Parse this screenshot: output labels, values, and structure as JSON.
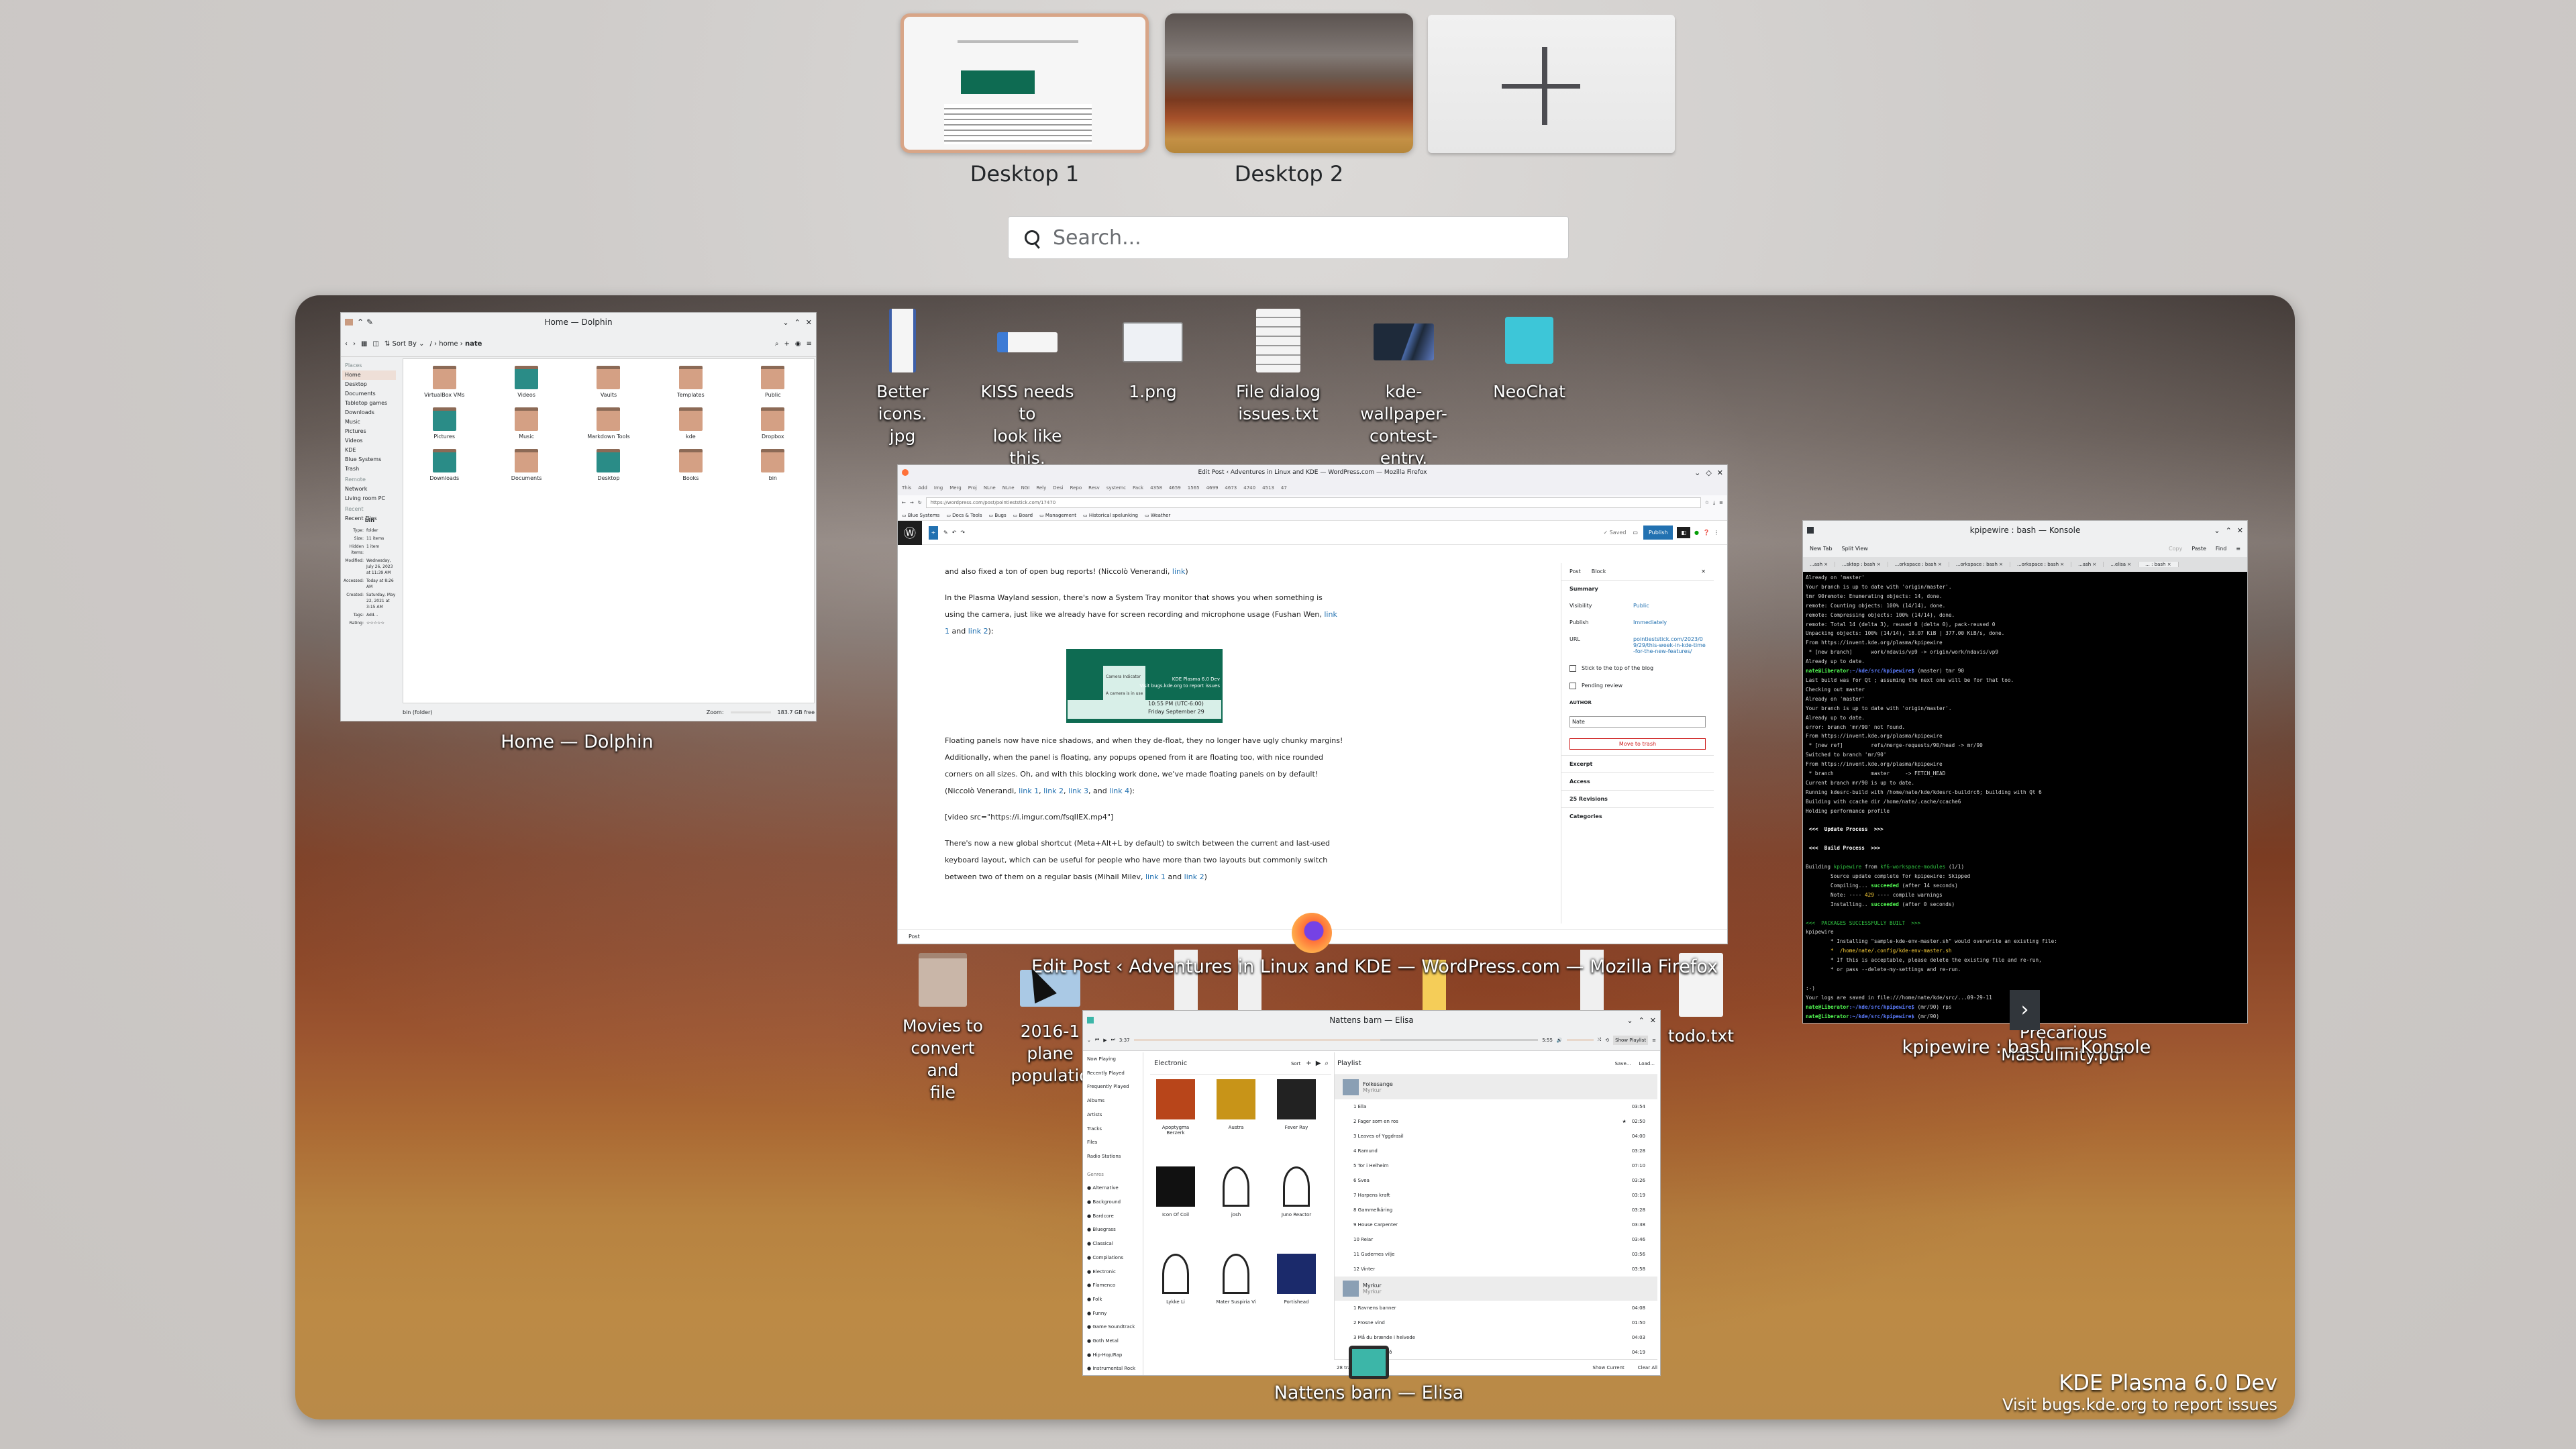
{
  "desktop_bar": {
    "desktops": [
      {
        "label": "Desktop 1",
        "active": true
      },
      {
        "label": "Desktop 2",
        "active": false
      }
    ],
    "add_desktop_icon": "plus-icon"
  },
  "search": {
    "placeholder": "Search...",
    "icon": "search-icon"
  },
  "desktop_icons": [
    {
      "label": "Better icons.\njpg",
      "icon": "image-file-icon"
    },
    {
      "label": "KISS needs to\nlook like this.\njpg",
      "icon": "image-file-icon"
    },
    {
      "label": "1.png",
      "icon": "image-file-icon"
    },
    {
      "label": "File dialog\nissues.txt",
      "icon": "text-file-icon"
    },
    {
      "label": "kde-wallpaper-\ncontest-entry.\npng",
      "icon": "image-file-icon"
    },
    {
      "label": "NeoChat",
      "icon": "neochat-icon"
    },
    {
      "label": "Movies to\nconvert and\nfile",
      "icon": "folder-icon"
    },
    {
      "label": "2016-1\nplane\npopulatio",
      "icon": "image-file-icon"
    },
    {
      "label": "todo.txt",
      "icon": "text-file-icon"
    },
    {
      "label": "Precarious\nMasculinity.pdf",
      "icon": "pdf-file-icon"
    }
  ],
  "windows": {
    "dolphin": {
      "title": "Home — Dolphin",
      "caption": "Home — Dolphin",
      "toolbar": {
        "sort_label": "Sort By",
        "breadcrumb": [
          "/",
          "home",
          "nate"
        ]
      },
      "places_header": "Places",
      "places": [
        "Home",
        "Desktop",
        "Documents",
        "Tabletop games",
        "Downloads",
        "Music",
        "Pictures",
        "Videos",
        "KDE",
        "Blue Systems",
        "Trash"
      ],
      "remote_header": "Remote",
      "remote": [
        "Network",
        "Living room PC"
      ],
      "recent_header": "Recent",
      "recent": [
        "Recent Files"
      ],
      "files": [
        "VirtualBox VMs",
        "Videos",
        "Vaults",
        "Templates",
        "Public",
        "Pictures",
        "Music",
        "Markdown Tools",
        "kde",
        "Dropbox",
        "Downloads",
        "Documents",
        "Desktop",
        "Books",
        "bin"
      ],
      "info_panel": {
        "name": "bin",
        "rows": [
          {
            "k": "Type:",
            "v": "folder"
          },
          {
            "k": "Size:",
            "v": "11 items"
          },
          {
            "k": "Hidden items:",
            "v": "1 item"
          },
          {
            "k": "Modified:",
            "v": "Wednesday, July 26, 2023 at 11:39 AM"
          },
          {
            "k": "Accessed:",
            "v": "Today at 8:26 AM"
          },
          {
            "k": "Created:",
            "v": "Saturday, May 22, 2021 at 3:15 AM"
          },
          {
            "k": "Tags:",
            "v": "Add..."
          },
          {
            "k": "Rating:",
            "v": "☆☆☆☆☆"
          }
        ]
      },
      "status": "bin (folder)",
      "zoom_label": "Zoom:",
      "free_space": "183.7 GB free"
    },
    "firefox": {
      "title": "Edit Post ‹ Adventures in Linux and KDE — WordPress.com — Mozilla Firefox",
      "caption": "Edit Post ‹ Adventures in Linux and KDE — WordPress.com — Mozilla Firefox",
      "tabs": [
        "This",
        "Add",
        "Img",
        "Merg",
        "Proj",
        "NLne",
        "NLne",
        "NGI",
        "Rely",
        "Desi",
        "Repo",
        "Resv",
        "systemc",
        "Pack",
        "4358",
        "4659",
        "1565",
        "4699",
        "4673",
        "4740",
        "4513",
        "47"
      ],
      "url": "https://wordpress.com/post/pointieststick.com/17470",
      "bookmarks": [
        "Blue Systems",
        "Docs & Tools",
        "Bugs",
        "Board",
        "Management",
        "Historical spelunking",
        "Weather"
      ],
      "editor": {
        "saved_label": "✓ Saved",
        "publish_label": "Publish"
      },
      "paragraphs": [
        {
          "text": "and also fixed a ton of open bug reports! (Niccolò Venerandi, ",
          "links": [
            "link"
          ],
          "tail": ")"
        },
        {
          "text": "In the Plasma Wayland session, there's now a System Tray monitor that shows you when something is using the camera, just like we already have for screen recording and microphone usage (Fushan Wen, ",
          "links": [
            "link 1",
            "link 2"
          ],
          "tail": "):"
        },
        {
          "text": "Floating panels now have nice shadows, and when they de-float, they no longer have ugly chunky margins! Additionally, when the panel is floating, any popups opened from it are floating too, with nice rounded corners on all sizes. Oh, and with this blocking work done, we've made floating panels on by default! (Niccolò Venerandi, ",
          "links": [
            "link 1",
            "link 2",
            "link 3",
            "link 4"
          ],
          "tail": "):"
        },
        {
          "text": "[video src=\"https://i.imgur.com/fsqIIEX.mp4\"]",
          "links": [],
          "tail": ""
        },
        {
          "text": "There's now a new global shortcut (Meta+Alt+L by default) to switch between the current and last-used keyboard layout, which can be useful for people who have more than two layouts but commonly switch between two of them on a regular basis (Mihail Milev, ",
          "links": [
            "link 1",
            "link 2"
          ],
          "tail": ")"
        }
      ],
      "camera_image": {
        "tooltip_title": "Camera Indicator",
        "tooltip_sub": "A camera is in use",
        "brand": "KDE Plasma 6.0 Dev",
        "brand_sub": "Visit bugs.kde.org to report issues",
        "time": "10:55 PM",
        "tz": "(UTC-6:00)",
        "date": "Friday September 29"
      },
      "sidebar": {
        "tabs": [
          "Post",
          "Block"
        ],
        "summary": "Summary",
        "rows": [
          {
            "k": "Visibility",
            "v": "Public"
          },
          {
            "k": "Publish",
            "v": "Immediately"
          },
          {
            "k": "URL",
            "v": "pointieststick.com/2023/09/29/this-week-in-kde-time-for-the-new-features/"
          }
        ],
        "checkboxes": [
          "Stick to the top of the blog",
          "Pending review"
        ],
        "author_label": "AUTHOR",
        "author": "Nate",
        "trash": "Move to trash",
        "sections": [
          "Excerpt",
          "Access",
          "25 Revisions",
          "Categories"
        ]
      },
      "footer": "Post"
    },
    "konsole": {
      "title": "kpipewire : bash — Konsole",
      "caption": "kpipewire : bash — Konsole",
      "toolbar": [
        "New Tab",
        "Split View",
        "Copy",
        "Paste",
        "Find"
      ],
      "tabs": [
        "...ash",
        "...sktop : bash",
        "...orkspace : bash",
        "...orkspace : bash",
        "...orkspace : bash",
        "...ash",
        "...elisa",
        "... : bash"
      ],
      "lines": [
        "Already on 'master'",
        "Your branch is up to date with 'origin/master'.",
        "tmr 90remote: Enumerating objects: 14, done.",
        "remote: Counting objects: 100% (14/14), done.",
        "remote: Compressing objects: 100% (14/14), done.",
        "remote: Total 14 (delta 3), reused 0 (delta 0), pack-reused 0",
        "Unpacking objects: 100% (14/14), 18.07 KiB | 377.00 KiB/s, done.",
        "From https://invent.kde.org/plasma/kpipewire",
        " * [new branch]      work/ndavis/vp9 -> origin/work/ndavis/vp9",
        "Already up to date.",
        "@@PROMPT@@ (master) tmr 90",
        "Last build was for Qt ; assuming the next one will be for that too.",
        "Checking out master",
        "Already on 'master'",
        "Your branch is up to date with 'origin/master'.",
        "Already up to date.",
        "error: branch 'mr/90' not found.",
        "From https://invent.kde.org/plasma/kpipewire",
        " * [new ref]         refs/merge-requests/90/head -> mr/90",
        "Switched to branch 'mr/90'",
        "From https://invent.kde.org/plasma/kpipewire",
        " * branch            master     -> FETCH_HEAD",
        "Current branch mr/90 is up to date.",
        "Running kdesrc-build with /home/nate/kde/kdesrc-buildrc6; building with Qt 6",
        "Building with ccache dir /home/nate/.cache/ccache6",
        "Holding performance profile",
        "",
        " <<<  Update Process  >>>",
        "",
        " <<<  Build Process  >>>",
        "",
        "Building kpipewire from kf6-workspace-modules (1/1)",
        "        Source update complete for kpipewire: Skipped",
        "        Compiling... succeeded (after 14 seconds)",
        "        Note: ---- 429 ---- compile warnings",
        "        Installing.. succeeded (after 0 seconds)",
        "",
        "<<<  PACKAGES SUCCESSFULLY BUILT  >>>",
        "kpipewire",
        "        * Installing \"sample-kde-env-master.sh\" would overwrite an existing file:",
        "        *  /home/nate/.config/kde-env-master.sh",
        "        * If this is acceptable, please delete the existing file and re-run,",
        "        * or pass --delete-my-settings and re-run.",
        "",
        ":-)",
        "Your logs are saved in file:///home/nate/kde/src/...09-29-11",
        "@@PROMPT@@ (mr/90) rps",
        "@@PROMPT@@ (mr/90) "
      ],
      "prompt_user": "nate@Liberator",
      "prompt_path": ":~/kde/src/kpipewire$"
    },
    "elisa": {
      "title": "Nattens barn — Elisa",
      "caption": "Nattens barn — Elisa",
      "elapsed": "3:37",
      "duration": "5:55",
      "progress": 0.61,
      "volume": 1.0,
      "show_playlist": "Show Playlist",
      "nav": [
        "Now Playing",
        "Recently Played",
        "Frequently Played",
        "Albums",
        "Artists",
        "Tracks",
        "Files",
        "Radio Stations"
      ],
      "genres_header": "Genres",
      "genres": [
        "Alternative",
        "Background",
        "Bardcore",
        "Bluegrass",
        "Classical",
        "Compilations",
        "Electronic",
        "Flamenco",
        "Folk",
        "Funny",
        "Game Soundtrack",
        "Goth Metal",
        "Hip-Hop/Rap",
        "Instrumental Rock"
      ],
      "grid_title": "Electronic",
      "sort_label": "Sort",
      "artists": [
        "Apoptygma Berzerk",
        "Austra",
        "Fever Ray",
        "Icon Of Coil",
        "josh",
        "Juno Reactor",
        "Lykke Li",
        "Mater Suspiria Vi",
        "Portishead"
      ],
      "playlist_title": "Playlist",
      "save_label": "Save...",
      "load_label": "Load...",
      "groups": [
        {
          "album": "Folkesange",
          "artist": "Myrkur",
          "tracks": [
            {
              "n": "1",
              "t": "Ella",
              "d": "03:54"
            },
            {
              "n": "2",
              "t": "Fager som en ros",
              "d": "02:50",
              "star": true
            },
            {
              "n": "3",
              "t": "Leaves of Yggdrasil",
              "d": "04:00"
            },
            {
              "n": "4",
              "t": "Ramund",
              "d": "03:28"
            },
            {
              "n": "5",
              "t": "Tor i Helheim",
              "d": "07:10"
            },
            {
              "n": "6",
              "t": "Svea",
              "d": "03:26"
            },
            {
              "n": "7",
              "t": "Harpens kraft",
              "d": "03:19"
            },
            {
              "n": "8",
              "t": "Gammelkäring",
              "d": "03:28"
            },
            {
              "n": "9",
              "t": "House Carpenter",
              "d": "03:38"
            },
            {
              "n": "10",
              "t": "Reiar",
              "d": "03:46"
            },
            {
              "n": "11",
              "t": "Gudernes vilje",
              "d": "03:56"
            },
            {
              "n": "12",
              "t": "Vinter",
              "d": "03:58"
            }
          ]
        },
        {
          "album": "Myrkur",
          "artist": "Myrkur",
          "tracks": [
            {
              "n": "1",
              "t": "Ravnens banner",
              "d": "04:08"
            },
            {
              "n": "2",
              "t": "Frosne vind",
              "d": "01:50"
            },
            {
              "n": "3",
              "t": "Må du brænde i helvede",
              "d": "04:03"
            },
            {
              "n": "4",
              "t": "Latvian fegurð",
              "d": "04:19"
            }
          ]
        }
      ],
      "footer": {
        "count": "28 tracks",
        "show_current": "Show Current",
        "clear_all": "Clear All"
      }
    }
  },
  "branding": {
    "title": "KDE Plasma 6.0 Dev",
    "subtitle": "Visit bugs.kde.org to report issues"
  }
}
